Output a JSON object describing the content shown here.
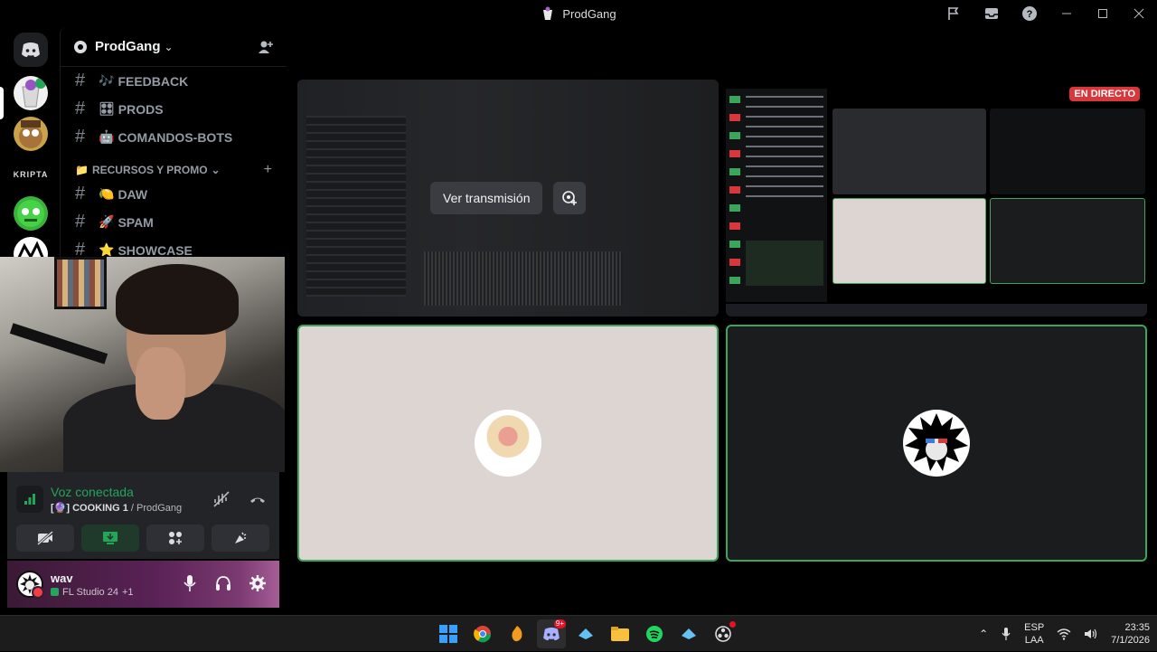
{
  "window": {
    "title": "ProdGang"
  },
  "server": {
    "name": "ProdGang"
  },
  "channels": [
    {
      "emoji": "🎶",
      "name": "FEEDBACK"
    },
    {
      "emoji": "🎛",
      "name": "PRODS"
    },
    {
      "emoji": "🤖",
      "name": "COMANDOS-BOTS"
    }
  ],
  "category": {
    "emoji": "📁",
    "name": "RECURSOS Y PROMO"
  },
  "channels2": [
    {
      "emoji": "🍋",
      "name": "DAW"
    },
    {
      "emoji": "🚀",
      "name": "SPAM"
    },
    {
      "emoji": "⭐",
      "name": "SHOWCASE"
    }
  ],
  "server_rail": {
    "label": "KRIPTA"
  },
  "voice": {
    "status": "Voz conectada",
    "channel_prefix": "[🔮] COOKING 1",
    "channel_server": "/ ProdGang"
  },
  "user": {
    "name": "wav",
    "activity": "FL Studio 24",
    "activity_extra": "+1"
  },
  "stream": {
    "watch_label": "Ver transmisión",
    "live_label": "EN DIRECTO"
  },
  "taskbar": {
    "lang_top": "ESP",
    "lang_bottom": "LAA",
    "time": "23:35",
    "date": "7/1/2026",
    "discord_badge": "9+"
  },
  "colors": {
    "accent_green": "#23a55a",
    "tile_border": "#3ba55c",
    "live_red": "#da373c"
  }
}
